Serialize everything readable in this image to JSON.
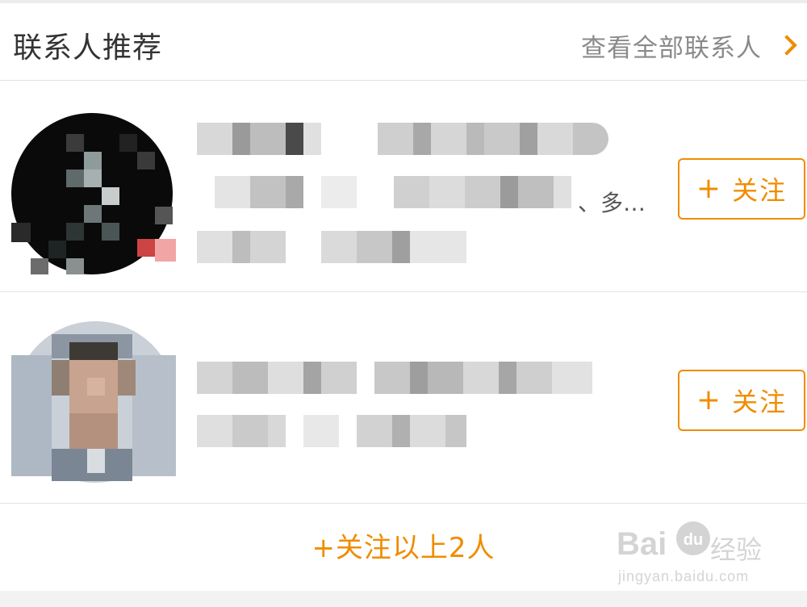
{
  "header": {
    "title": "联系人推荐",
    "view_all_label": "查看全部联系人"
  },
  "contacts": [
    {
      "description_tail": "、多…",
      "follow_label": "关注",
      "avatar_icon": "avatar-pixelated"
    },
    {
      "follow_label": "关注",
      "avatar_icon": "avatar-pixelated"
    }
  ],
  "footer": {
    "follow_all_label": "+关注以上2人"
  },
  "watermark": {
    "brand": "Bai",
    "brand_suffix": "经验",
    "url": "jingyan.baidu.com"
  },
  "colors": {
    "accent": "#f08c00",
    "title_text": "#333333",
    "secondary_text": "#8a8a8a",
    "divider": "#e3e3e3"
  }
}
